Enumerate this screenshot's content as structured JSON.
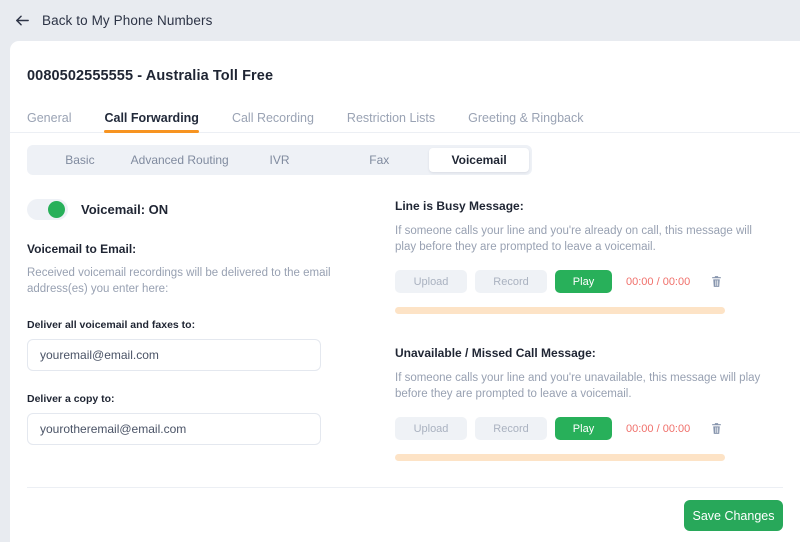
{
  "topbar": {
    "back_label": "Back to My Phone Numbers",
    "back_icon": "arrow-left-icon"
  },
  "card": {
    "title": "0080502555555 - Australia Toll Free"
  },
  "main_tabs": [
    {
      "label": "General",
      "active": false
    },
    {
      "label": "Call Forwarding",
      "active": true
    },
    {
      "label": "Call Recording",
      "active": false
    },
    {
      "label": "Restriction Lists",
      "active": false
    },
    {
      "label": "Greeting & Ringback",
      "active": false
    }
  ],
  "sub_tabs": [
    {
      "label": "Basic",
      "active": false
    },
    {
      "label": "Advanced Routing",
      "active": false
    },
    {
      "label": "IVR",
      "active": false
    },
    {
      "label": "Fax",
      "active": false
    },
    {
      "label": "Voicemail",
      "active": true
    }
  ],
  "left": {
    "toggle": {
      "label": "Voicemail: ON",
      "state": "on"
    },
    "voicemail_to_email": {
      "heading": "Voicemail to Email:",
      "description": "Received voicemail recordings will be delivered to the email address(es) you enter here:"
    },
    "deliver_all": {
      "label": "Deliver all voicemail and faxes to:",
      "value": "youremail@email.com",
      "placeholder": "youremail@email.com"
    },
    "deliver_copy": {
      "label": "Deliver a copy to:",
      "value": "yourotheremail@email.com",
      "placeholder": "yourotheremail@email.com"
    }
  },
  "right": {
    "busy": {
      "heading": "Line is Busy Message:",
      "description": "If someone calls your line and you're already on call, this message will play before they are prompted to leave a voicemail.",
      "upload_label": "Upload",
      "record_label": "Record",
      "play_label": "Play",
      "time": "00:00 / 00:00",
      "delete_icon": "trash-icon",
      "progress_percent": 100
    },
    "unavailable": {
      "heading": "Unavailable / Missed Call Message:",
      "description": "If someone calls your line and you're unavailable, this message will play before they are prompted to leave a voicemail.",
      "upload_label": "Upload",
      "record_label": "Record",
      "play_label": "Play",
      "time": "00:00 / 00:00",
      "delete_icon": "trash-icon",
      "progress_percent": 100
    }
  },
  "footer": {
    "save_label": "Save Changes"
  },
  "colors": {
    "page_background": "#e8ebf0",
    "accent_orange": "#f79421",
    "green": "#28b05a",
    "time_red": "#f0706b",
    "progress_peach": "#fde3c6",
    "muted_text": "#98a1b2"
  }
}
